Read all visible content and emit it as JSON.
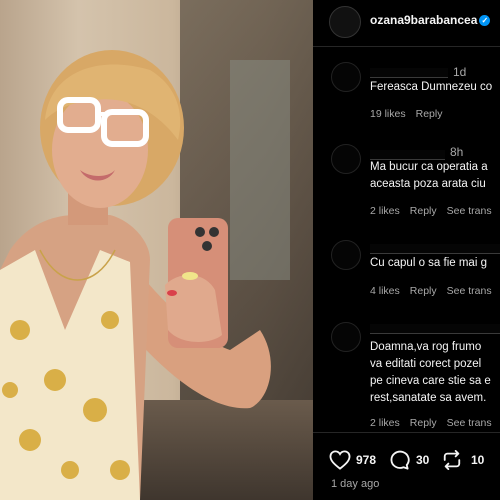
{
  "post": {
    "username": "ozana9barabancea",
    "verified_mark": "✓"
  },
  "comments": [
    {
      "time": "1d",
      "text_lines": [
        "Fereasca Dumnezeu co"
      ],
      "likes": "19 likes",
      "reply": "Reply",
      "see_translation": ""
    },
    {
      "time": "8h",
      "text_lines": [
        "Ma bucur ca operatia a",
        "aceasta poza arata ciu"
      ],
      "likes": "2 likes",
      "reply": "Reply",
      "see_translation": "See trans"
    },
    {
      "time": "",
      "text_lines": [
        "Cu capul o sa fie mai g"
      ],
      "likes": "4 likes",
      "reply": "Reply",
      "see_translation": "See trans"
    },
    {
      "time": "",
      "text_lines": [
        "Doamna,va rog frumo",
        "va editati corect pozel",
        "pe cineva care stie sa e",
        "rest,sanatate sa avem."
      ],
      "likes": "2 likes",
      "reply": "Reply",
      "see_translation": "See trans"
    }
  ],
  "actions": {
    "likes": "978",
    "comments": "30",
    "reposts": "10"
  },
  "posted_ago": "1 day ago",
  "icons": {
    "heart": "heart-icon",
    "comment": "comment-bubble-icon",
    "repost": "repost-icon"
  }
}
